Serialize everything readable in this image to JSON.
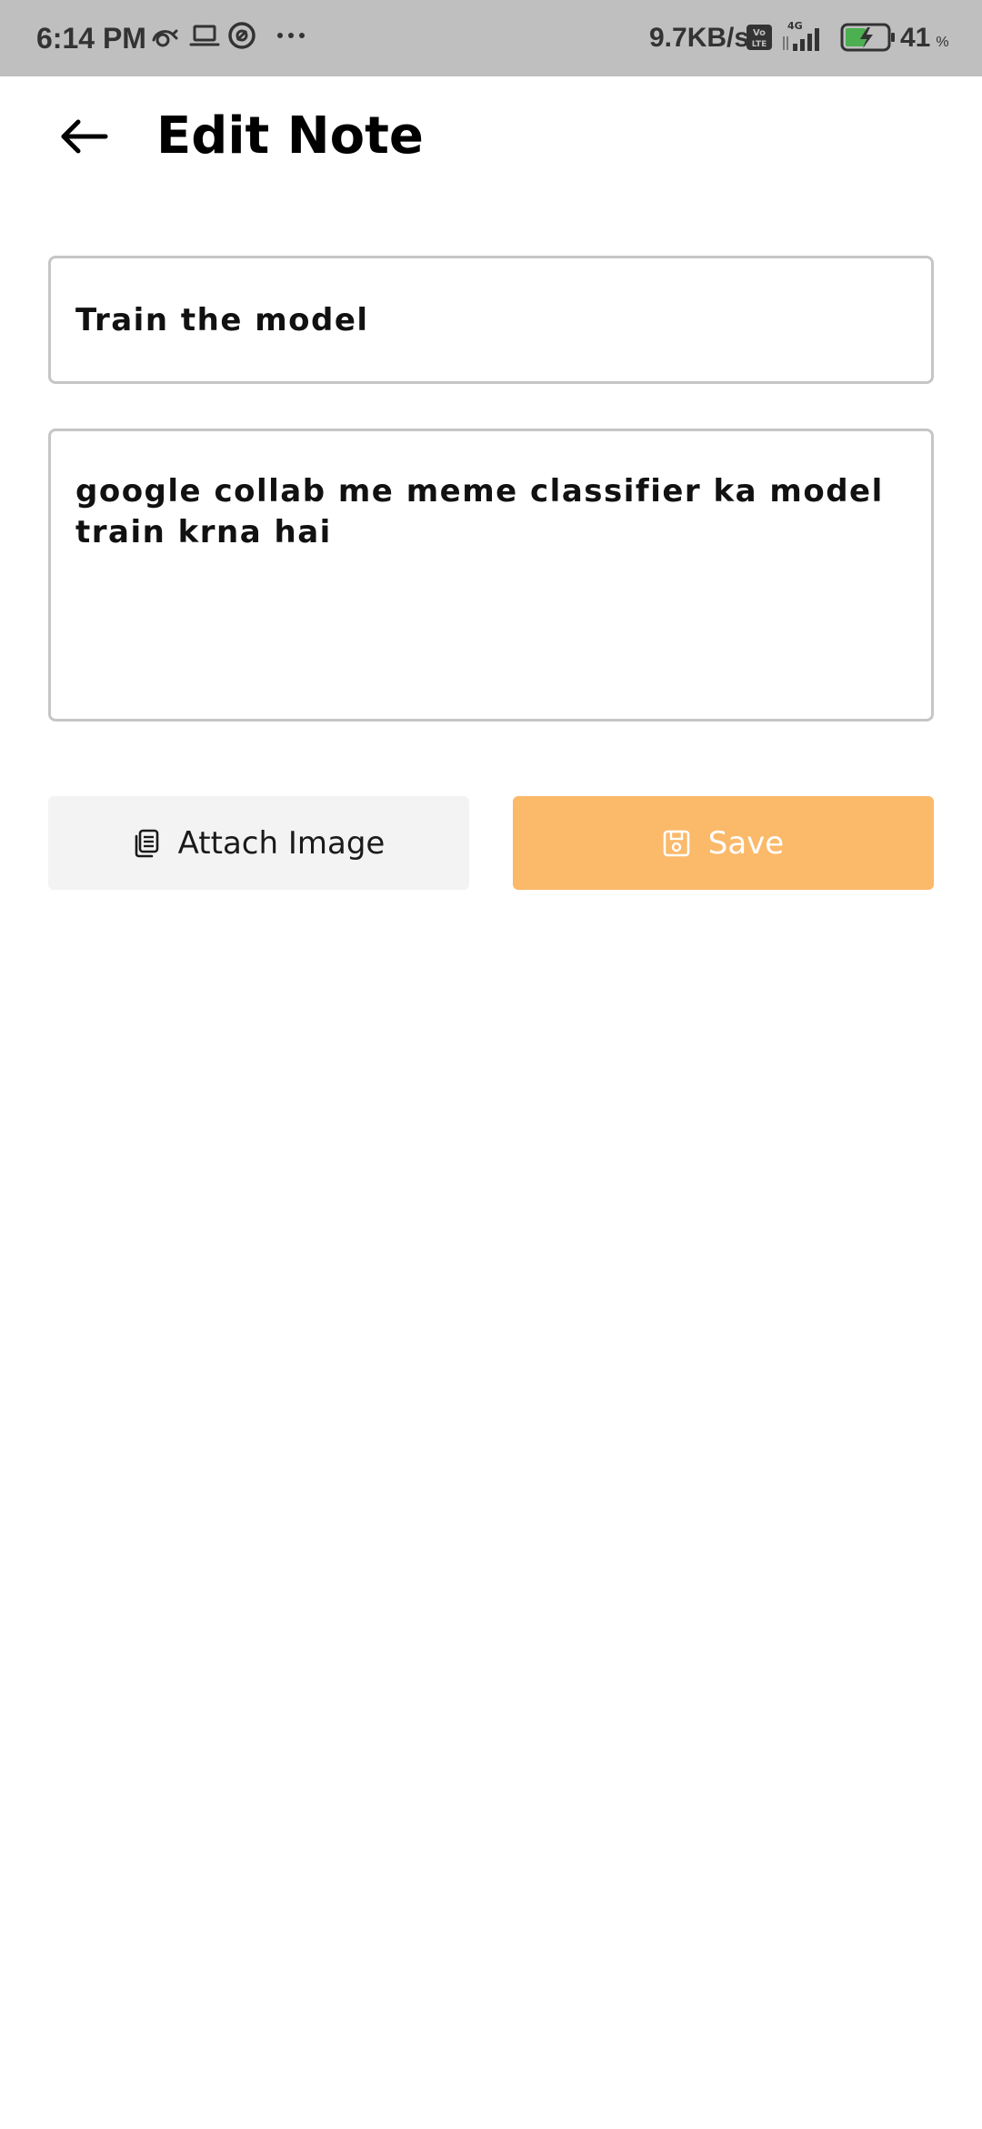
{
  "status_bar": {
    "time": "6:14 PM",
    "network_speed": "9.7KB/s",
    "network_type": "4G",
    "volte_label": "Vo LTE",
    "battery_percent": "41",
    "battery_unit": "%",
    "notification_icons": [
      "sync-icon",
      "laptop-icon",
      "circle-app-icon",
      "more-dots-icon"
    ]
  },
  "header": {
    "title": "Edit Note",
    "back_icon": "arrow-left-icon"
  },
  "form": {
    "title_value": "Train the model",
    "body_value": "google collab me meme classifier ka model train krna hai"
  },
  "actions": {
    "attach_label": "Attach Image",
    "attach_icon": "copy-icon",
    "save_label": "Save",
    "save_icon": "floppy-icon"
  },
  "colors": {
    "status_bar_bg": "#bfbfbf",
    "save_button_bg": "#fbb96a",
    "attach_button_bg": "#f3f3f3",
    "input_border": "#c6c6c6",
    "battery_charge": "#4caf50"
  }
}
